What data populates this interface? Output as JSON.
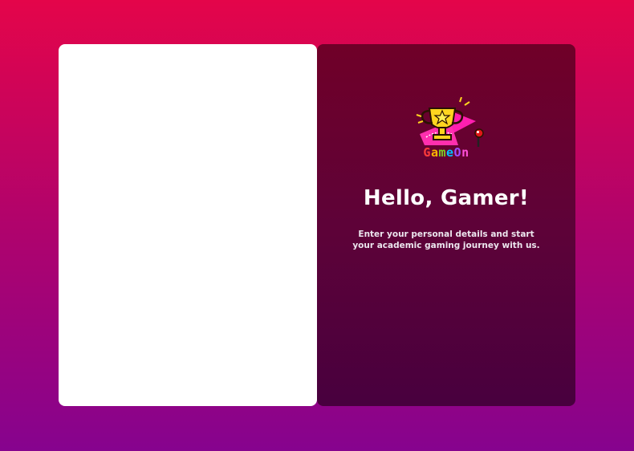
{
  "welcome_panel": {
    "logo_name": "GameOn!",
    "logo_letters": [
      "G",
      "a",
      "m",
      "e",
      "O",
      "n"
    ],
    "title": "Hello, Gamer!",
    "subtitle": "Enter your personal details and start your academic gaming journey with us."
  },
  "colors": {
    "background_top": "#e4054a",
    "background_bottom": "#86038e",
    "panel_top": "#700028",
    "panel_bottom": "#48003e",
    "form_panel": "#ffffff"
  },
  "icons": [
    "trophy-icon",
    "joystick-icon",
    "star-icon"
  ]
}
